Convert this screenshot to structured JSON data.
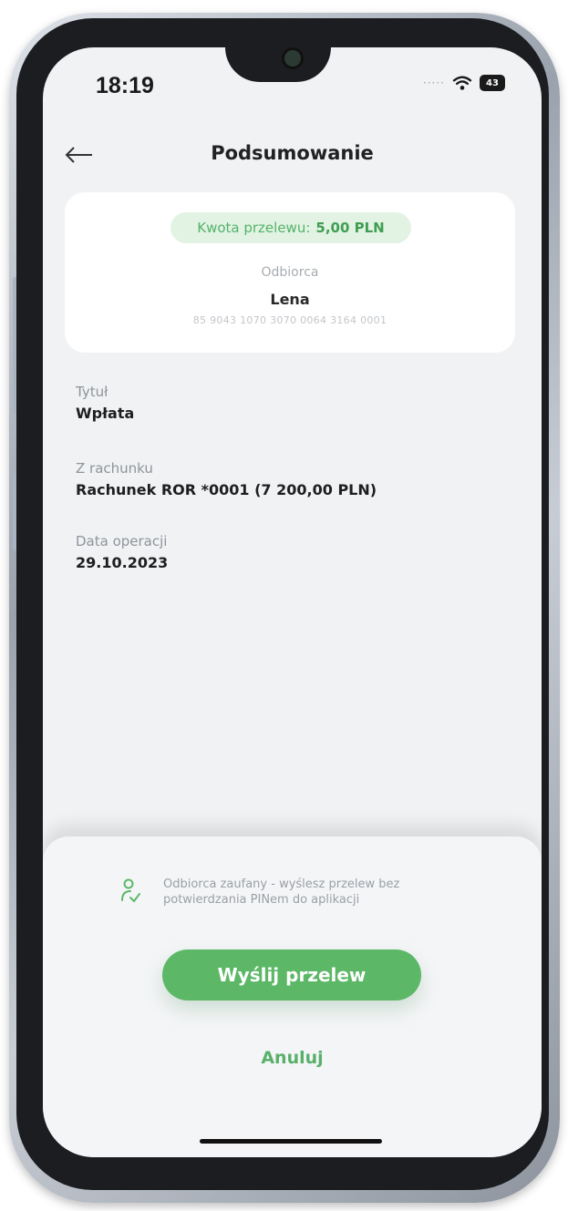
{
  "status_bar": {
    "time": "18:19",
    "signal_dots": "·····",
    "battery": "43"
  },
  "header": {
    "title": "Podsumowanie",
    "back_icon": "arrow-left-icon"
  },
  "summary": {
    "amount_label": "Kwota przelewu:",
    "amount_value": "5,00 PLN",
    "recipient_caption": "Odbiorca",
    "recipient_name": "Lena",
    "recipient_account": "85 9043 1070 3070 0064 3164 0001"
  },
  "details": [
    {
      "label": "Tytuł",
      "value": "Wpłata"
    },
    {
      "label": "Z rachunku",
      "value": "Rachunek ROR *0001 (7 200,00 PLN)"
    },
    {
      "label": "Data operacji",
      "value": "29.10.2023"
    }
  ],
  "bottom_sheet": {
    "trusted_icon": "trusted-user-icon",
    "trusted_text": "Odbiorca zaufany - wyślesz przelew bez potwierdzania PINem do aplikacji",
    "send_label": "Wyślij przelew",
    "cancel_label": "Anuluj"
  },
  "colors": {
    "accent_green": "#5cb867",
    "pill_background": "#e2f3e3",
    "screen_background": "#f0f2f4"
  }
}
